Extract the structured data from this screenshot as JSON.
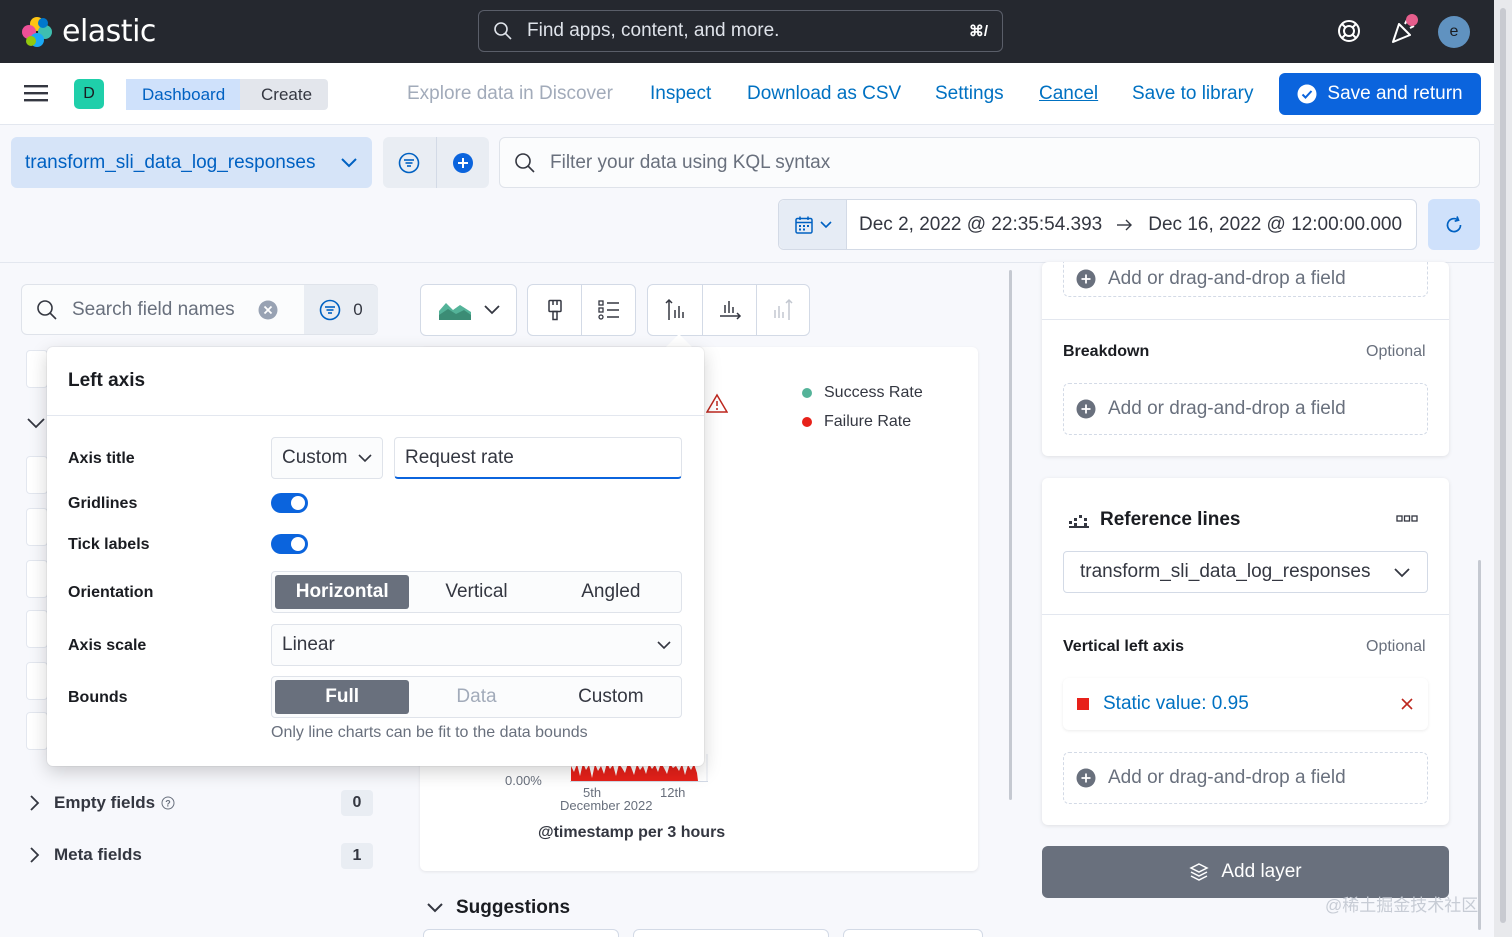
{
  "app": {
    "name": "elastic"
  },
  "topbar": {
    "search_placeholder": "Find apps, content, and more.",
    "search_shortcut": "⌘/",
    "avatar_initial": "e"
  },
  "header": {
    "space_initial": "D",
    "breadcrumbs": [
      "Dashboard",
      "Create"
    ],
    "links": {
      "explore": "Explore data in Discover",
      "inspect": "Inspect",
      "download": "Download as CSV",
      "settings": "Settings",
      "cancel": "Cancel",
      "save_library": "Save to library"
    },
    "save_return": "Save and return"
  },
  "query": {
    "data_view": "transform_sli_data_log_responses",
    "kql_placeholder": "Filter your data using KQL syntax",
    "date_start": "Dec 2, 2022 @ 22:35:54.393",
    "date_end": "Dec 16, 2022 @ 12:00:00.000"
  },
  "fields": {
    "search_placeholder": "Search field names",
    "filter_count": "0",
    "empty_label": "Empty fields",
    "empty_count": "0",
    "meta_label": "Meta fields",
    "meta_count": "1"
  },
  "popover": {
    "title": "Left axis",
    "axis_title_label": "Axis title",
    "axis_title_mode": "Custom",
    "axis_title_value": "Request rate",
    "gridlines_label": "Gridlines",
    "gridlines_on": true,
    "tick_labels_label": "Tick labels",
    "tick_labels_on": true,
    "orientation_label": "Orientation",
    "orientation_options": [
      "Horizontal",
      "Vertical",
      "Angled"
    ],
    "orientation_selected": "Horizontal",
    "scale_label": "Axis scale",
    "scale_value": "Linear",
    "bounds_label": "Bounds",
    "bounds_options": [
      "Full",
      "Data",
      "Custom"
    ],
    "bounds_selected": "Full",
    "bounds_help": "Only line charts can be fit to the data bounds"
  },
  "chart": {
    "legend": [
      {
        "name": "Success Rate",
        "color": "#54b399"
      },
      {
        "name": "Failure Rate",
        "color": "#e7211a"
      }
    ],
    "y_tick": "0.00%",
    "x_ticks": [
      "5th",
      "12th"
    ],
    "x_period": "December 2022",
    "x_title": "@timestamp per 3 hours"
  },
  "suggestions_label": "Suggestions",
  "config": {
    "top_dropzone": "Add or drag-and-drop a field",
    "breakdown_label": "Breakdown",
    "breakdown_optional": "Optional",
    "breakdown_dropzone": "Add or drag-and-drop a field",
    "ref_title": "Reference lines",
    "ref_dataview": "transform_sli_data_log_responses",
    "vleft_label": "Vertical left axis",
    "vleft_optional": "Optional",
    "static_value": "Static value: 0.95",
    "vleft_dropzone": "Add or drag-and-drop a field",
    "add_layer": "Add layer"
  },
  "watermark": "@稀土掘金技术社区",
  "colors": {
    "primary": "#0b64dd",
    "topbar": "#25282f",
    "failure": "#e7211a",
    "success": "#54b399"
  }
}
